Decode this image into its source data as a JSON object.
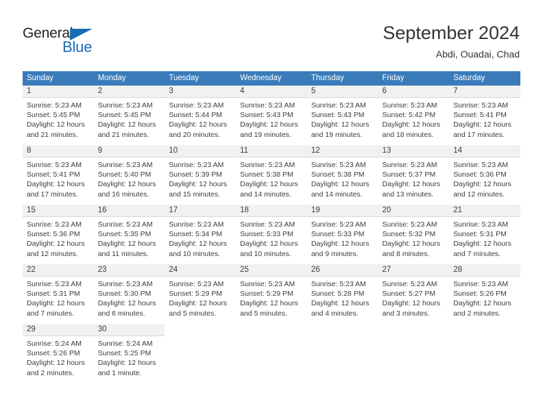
{
  "brand": {
    "name_part1": "General",
    "name_part2": "Blue",
    "triangle_icon": "triangle-icon",
    "colors": {
      "dark": "#231f20",
      "blue": "#1c6cb5"
    }
  },
  "header": {
    "month_title": "September 2024",
    "location": "Abdi, Ouadai, Chad"
  },
  "calendar": {
    "header_color": "#3a7cba",
    "weekdays": [
      "Sunday",
      "Monday",
      "Tuesday",
      "Wednesday",
      "Thursday",
      "Friday",
      "Saturday"
    ],
    "weeks": [
      [
        {
          "day": "1",
          "sunrise": "Sunrise: 5:23 AM",
          "sunset": "Sunset: 5:45 PM",
          "daylight1": "Daylight: 12 hours",
          "daylight2": "and 21 minutes."
        },
        {
          "day": "2",
          "sunrise": "Sunrise: 5:23 AM",
          "sunset": "Sunset: 5:45 PM",
          "daylight1": "Daylight: 12 hours",
          "daylight2": "and 21 minutes."
        },
        {
          "day": "3",
          "sunrise": "Sunrise: 5:23 AM",
          "sunset": "Sunset: 5:44 PM",
          "daylight1": "Daylight: 12 hours",
          "daylight2": "and 20 minutes."
        },
        {
          "day": "4",
          "sunrise": "Sunrise: 5:23 AM",
          "sunset": "Sunset: 5:43 PM",
          "daylight1": "Daylight: 12 hours",
          "daylight2": "and 19 minutes."
        },
        {
          "day": "5",
          "sunrise": "Sunrise: 5:23 AM",
          "sunset": "Sunset: 5:43 PM",
          "daylight1": "Daylight: 12 hours",
          "daylight2": "and 19 minutes."
        },
        {
          "day": "6",
          "sunrise": "Sunrise: 5:23 AM",
          "sunset": "Sunset: 5:42 PM",
          "daylight1": "Daylight: 12 hours",
          "daylight2": "and 18 minutes."
        },
        {
          "day": "7",
          "sunrise": "Sunrise: 5:23 AM",
          "sunset": "Sunset: 5:41 PM",
          "daylight1": "Daylight: 12 hours",
          "daylight2": "and 17 minutes."
        }
      ],
      [
        {
          "day": "8",
          "sunrise": "Sunrise: 5:23 AM",
          "sunset": "Sunset: 5:41 PM",
          "daylight1": "Daylight: 12 hours",
          "daylight2": "and 17 minutes."
        },
        {
          "day": "9",
          "sunrise": "Sunrise: 5:23 AM",
          "sunset": "Sunset: 5:40 PM",
          "daylight1": "Daylight: 12 hours",
          "daylight2": "and 16 minutes."
        },
        {
          "day": "10",
          "sunrise": "Sunrise: 5:23 AM",
          "sunset": "Sunset: 5:39 PM",
          "daylight1": "Daylight: 12 hours",
          "daylight2": "and 15 minutes."
        },
        {
          "day": "11",
          "sunrise": "Sunrise: 5:23 AM",
          "sunset": "Sunset: 5:38 PM",
          "daylight1": "Daylight: 12 hours",
          "daylight2": "and 14 minutes."
        },
        {
          "day": "12",
          "sunrise": "Sunrise: 5:23 AM",
          "sunset": "Sunset: 5:38 PM",
          "daylight1": "Daylight: 12 hours",
          "daylight2": "and 14 minutes."
        },
        {
          "day": "13",
          "sunrise": "Sunrise: 5:23 AM",
          "sunset": "Sunset: 5:37 PM",
          "daylight1": "Daylight: 12 hours",
          "daylight2": "and 13 minutes."
        },
        {
          "day": "14",
          "sunrise": "Sunrise: 5:23 AM",
          "sunset": "Sunset: 5:36 PM",
          "daylight1": "Daylight: 12 hours",
          "daylight2": "and 12 minutes."
        }
      ],
      [
        {
          "day": "15",
          "sunrise": "Sunrise: 5:23 AM",
          "sunset": "Sunset: 5:36 PM",
          "daylight1": "Daylight: 12 hours",
          "daylight2": "and 12 minutes."
        },
        {
          "day": "16",
          "sunrise": "Sunrise: 5:23 AM",
          "sunset": "Sunset: 5:35 PM",
          "daylight1": "Daylight: 12 hours",
          "daylight2": "and 11 minutes."
        },
        {
          "day": "17",
          "sunrise": "Sunrise: 5:23 AM",
          "sunset": "Sunset: 5:34 PM",
          "daylight1": "Daylight: 12 hours",
          "daylight2": "and 10 minutes."
        },
        {
          "day": "18",
          "sunrise": "Sunrise: 5:23 AM",
          "sunset": "Sunset: 5:33 PM",
          "daylight1": "Daylight: 12 hours",
          "daylight2": "and 10 minutes."
        },
        {
          "day": "19",
          "sunrise": "Sunrise: 5:23 AM",
          "sunset": "Sunset: 5:33 PM",
          "daylight1": "Daylight: 12 hours",
          "daylight2": "and 9 minutes."
        },
        {
          "day": "20",
          "sunrise": "Sunrise: 5:23 AM",
          "sunset": "Sunset: 5:32 PM",
          "daylight1": "Daylight: 12 hours",
          "daylight2": "and 8 minutes."
        },
        {
          "day": "21",
          "sunrise": "Sunrise: 5:23 AM",
          "sunset": "Sunset: 5:31 PM",
          "daylight1": "Daylight: 12 hours",
          "daylight2": "and 7 minutes."
        }
      ],
      [
        {
          "day": "22",
          "sunrise": "Sunrise: 5:23 AM",
          "sunset": "Sunset: 5:31 PM",
          "daylight1": "Daylight: 12 hours",
          "daylight2": "and 7 minutes."
        },
        {
          "day": "23",
          "sunrise": "Sunrise: 5:23 AM",
          "sunset": "Sunset: 5:30 PM",
          "daylight1": "Daylight: 12 hours",
          "daylight2": "and 6 minutes."
        },
        {
          "day": "24",
          "sunrise": "Sunrise: 5:23 AM",
          "sunset": "Sunset: 5:29 PM",
          "daylight1": "Daylight: 12 hours",
          "daylight2": "and 5 minutes."
        },
        {
          "day": "25",
          "sunrise": "Sunrise: 5:23 AM",
          "sunset": "Sunset: 5:29 PM",
          "daylight1": "Daylight: 12 hours",
          "daylight2": "and 5 minutes."
        },
        {
          "day": "26",
          "sunrise": "Sunrise: 5:23 AM",
          "sunset": "Sunset: 5:28 PM",
          "daylight1": "Daylight: 12 hours",
          "daylight2": "and 4 minutes."
        },
        {
          "day": "27",
          "sunrise": "Sunrise: 5:23 AM",
          "sunset": "Sunset: 5:27 PM",
          "daylight1": "Daylight: 12 hours",
          "daylight2": "and 3 minutes."
        },
        {
          "day": "28",
          "sunrise": "Sunrise: 5:23 AM",
          "sunset": "Sunset: 5:26 PM",
          "daylight1": "Daylight: 12 hours",
          "daylight2": "and 2 minutes."
        }
      ],
      [
        {
          "day": "29",
          "sunrise": "Sunrise: 5:24 AM",
          "sunset": "Sunset: 5:26 PM",
          "daylight1": "Daylight: 12 hours",
          "daylight2": "and 2 minutes."
        },
        {
          "day": "30",
          "sunrise": "Sunrise: 5:24 AM",
          "sunset": "Sunset: 5:25 PM",
          "daylight1": "Daylight: 12 hours",
          "daylight2": "and 1 minute."
        },
        {
          "day": "",
          "sunrise": "",
          "sunset": "",
          "daylight1": "",
          "daylight2": ""
        },
        {
          "day": "",
          "sunrise": "",
          "sunset": "",
          "daylight1": "",
          "daylight2": ""
        },
        {
          "day": "",
          "sunrise": "",
          "sunset": "",
          "daylight1": "",
          "daylight2": ""
        },
        {
          "day": "",
          "sunrise": "",
          "sunset": "",
          "daylight1": "",
          "daylight2": ""
        },
        {
          "day": "",
          "sunrise": "",
          "sunset": "",
          "daylight1": "",
          "daylight2": ""
        }
      ]
    ]
  }
}
